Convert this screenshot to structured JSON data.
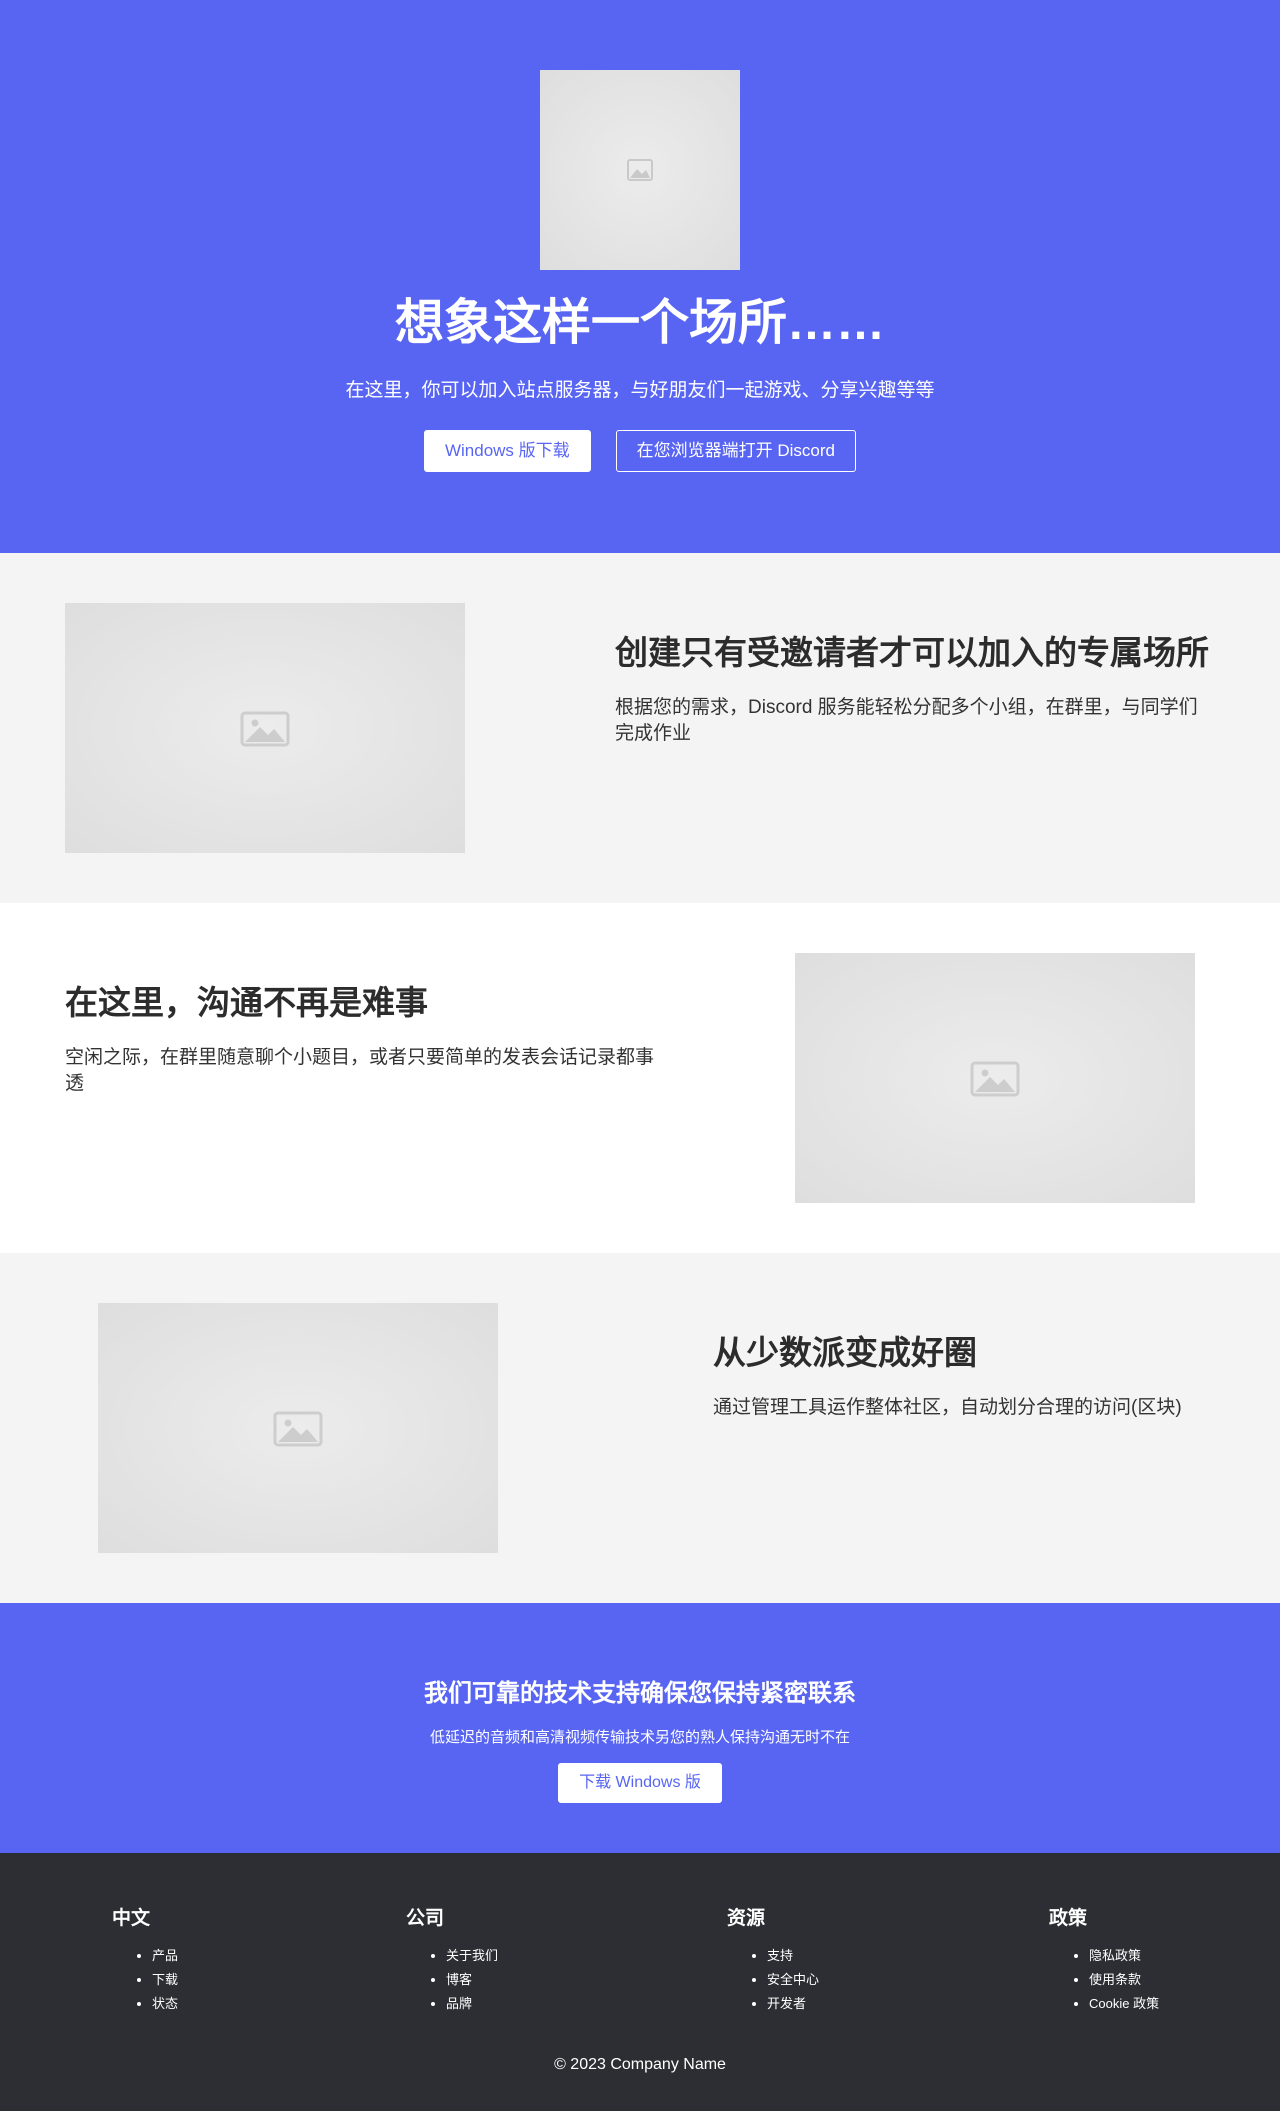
{
  "hero": {
    "title": "想象这样一个场所……",
    "subtitle": "在这里，你可以加入站点服务器，与好朋友们一起游戏、分享兴趣等等",
    "download_label": "Windows 版下载",
    "browser_label": "在您浏览器端打开 Discord",
    "image_icon": "image-placeholder-icon"
  },
  "features": [
    {
      "title": "创建只有受邀请者才可以加入的专属场所",
      "text": "根据您的需求，Discord 服务能轻松分配多个小组，在群里，与同学们完成作业"
    },
    {
      "title": "在这里，沟通不再是难事",
      "text": "空闲之际，在群里随意聊个小题目，或者只要简单的发表会话记录都事透"
    },
    {
      "title": "从少数派变成好圈",
      "text": "通过管理工具运作整体社区，自动划分合理的访问(区块)"
    }
  ],
  "cta": {
    "title": "我们可靠的技术支持确保您保持紧密联系",
    "text": "低延迟的音频和高清视频传输技术另您的熟人保持沟通无时不在",
    "button_label": "下载 Windows 版"
  },
  "footer": {
    "columns": [
      {
        "heading": "中文",
        "items": [
          "产品",
          "下载",
          "状态"
        ]
      },
      {
        "heading": "公司",
        "items": [
          "关于我们",
          "博客",
          "品牌"
        ]
      },
      {
        "heading": "资源",
        "items": [
          "支持",
          "安全中心",
          "开发者"
        ]
      },
      {
        "heading": "政策",
        "items": [
          "隐私政策",
          "使用条款",
          "Cookie 政策"
        ]
      }
    ],
    "copyright": "© 2023 Company Name"
  },
  "colors": {
    "brand": "#5865f2",
    "footer_bg": "#2c2e33",
    "section_gray": "#f4f4f4"
  }
}
